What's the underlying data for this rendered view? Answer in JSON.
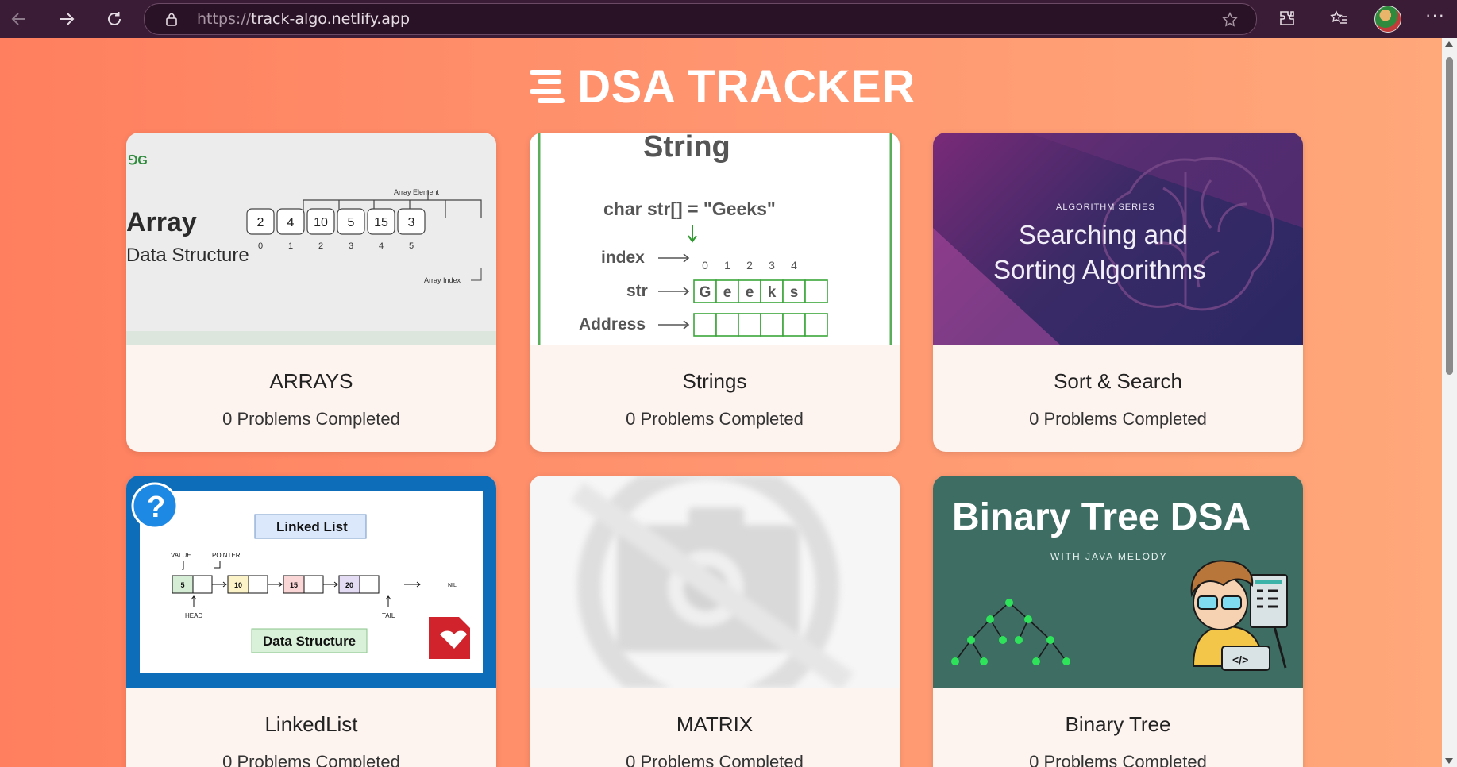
{
  "browser": {
    "url_protocol": "https://",
    "url_host": "track-algo.netlify.app",
    "icons": [
      "back-icon",
      "forward-icon",
      "refresh-icon",
      "lock-icon",
      "star-icon",
      "extensions-icon",
      "favorites-icon",
      "profile-avatar",
      "more-icon"
    ]
  },
  "header": {
    "title": "DSA TRACKER"
  },
  "cards": [
    {
      "title": "ARRAYS",
      "count_text": "0 Problems Completed",
      "thumb": {
        "logo": "⅁G",
        "heading": "Array",
        "subheading": "Data Structure",
        "element_label": "Array Element",
        "index_label": "Array Index",
        "values": [
          "2",
          "4",
          "10",
          "5",
          "15",
          "3"
        ],
        "indices": [
          "0",
          "1",
          "2",
          "3",
          "4",
          "5"
        ]
      }
    },
    {
      "title": "Strings",
      "count_text": "0 Problems Completed",
      "thumb": {
        "heading": "String",
        "declaration": "char str[] = \"Geeks\"",
        "row_index": "index",
        "row_str": "str",
        "row_address": "Address",
        "indices": [
          "0",
          "1",
          "2",
          "3",
          "4"
        ],
        "chars": [
          "G",
          "e",
          "e",
          "k",
          "s",
          ""
        ]
      }
    },
    {
      "title": "Sort & Search",
      "count_text": "0 Problems Completed",
      "thumb": {
        "series": "ALGORITHM SERIES",
        "line1": "Searching and",
        "line2": "Sorting Algorithms"
      }
    },
    {
      "title": "LinkedList",
      "count_text": "0 Problems Completed",
      "thumb": {
        "badge": "?",
        "heading": "Linked List",
        "footer": "Data Structure",
        "value_label": "VALUE",
        "pointer_label": "POINTER",
        "head_label": "HEAD",
        "tail_label": "TAIL",
        "nil_label": "NIL",
        "nodes": [
          "5",
          "10",
          "15",
          "20"
        ]
      }
    },
    {
      "title": "MATRIX",
      "count_text": "0 Problems Completed",
      "thumb": {}
    },
    {
      "title": "Binary Tree",
      "count_text": "0 Problems Completed",
      "thumb": {
        "heading": "Binary Tree DSA",
        "subheading": "WITH JAVA MELODY"
      }
    }
  ]
}
